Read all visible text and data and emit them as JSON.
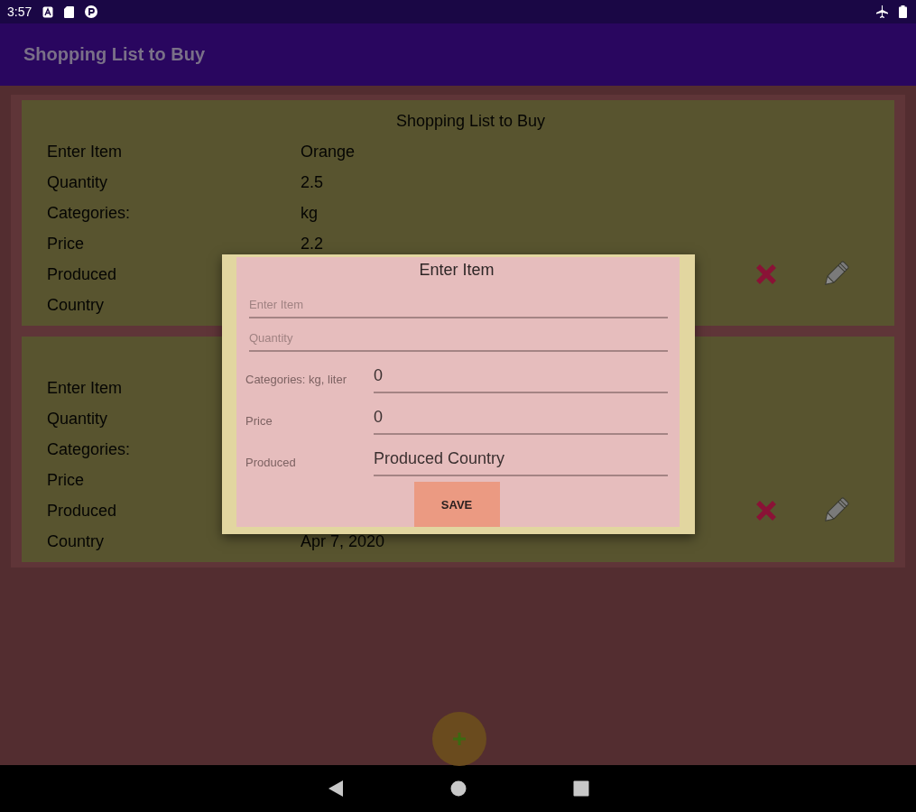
{
  "status_bar": {
    "time": "3:57"
  },
  "app_bar": {
    "title": "Shopping List to Buy"
  },
  "cards": [
    {
      "title": "Shopping List to Buy",
      "rows": [
        {
          "label": "Enter Item",
          "value": "Orange"
        },
        {
          "label": "Quantity",
          "value": "2.5"
        },
        {
          "label": "Categories:",
          "value": "kg"
        },
        {
          "label": "Price",
          "value": "2.2"
        },
        {
          "label": "Produced"
        },
        {
          "label": "Country"
        }
      ]
    },
    {
      "rows": [
        {
          "label": "Enter Item"
        },
        {
          "label": "Quantity"
        },
        {
          "label": "Categories:"
        },
        {
          "label": "Price"
        },
        {
          "label": "Produced"
        },
        {
          "label": "Country",
          "value": "Apr 7, 2020"
        }
      ]
    }
  ],
  "dialog": {
    "title": "Enter Item",
    "fields": [
      {
        "kind": "plain",
        "placeholder": "Enter Item"
      },
      {
        "kind": "plain",
        "placeholder": "Quantity"
      },
      {
        "kind": "labeled",
        "label": "Categories: kg, liter",
        "value": "0"
      },
      {
        "kind": "labeled",
        "label": "Price",
        "value": "0"
      },
      {
        "kind": "labeled",
        "label": "Produced",
        "value": "Produced Country"
      }
    ],
    "button": "SAVE"
  }
}
